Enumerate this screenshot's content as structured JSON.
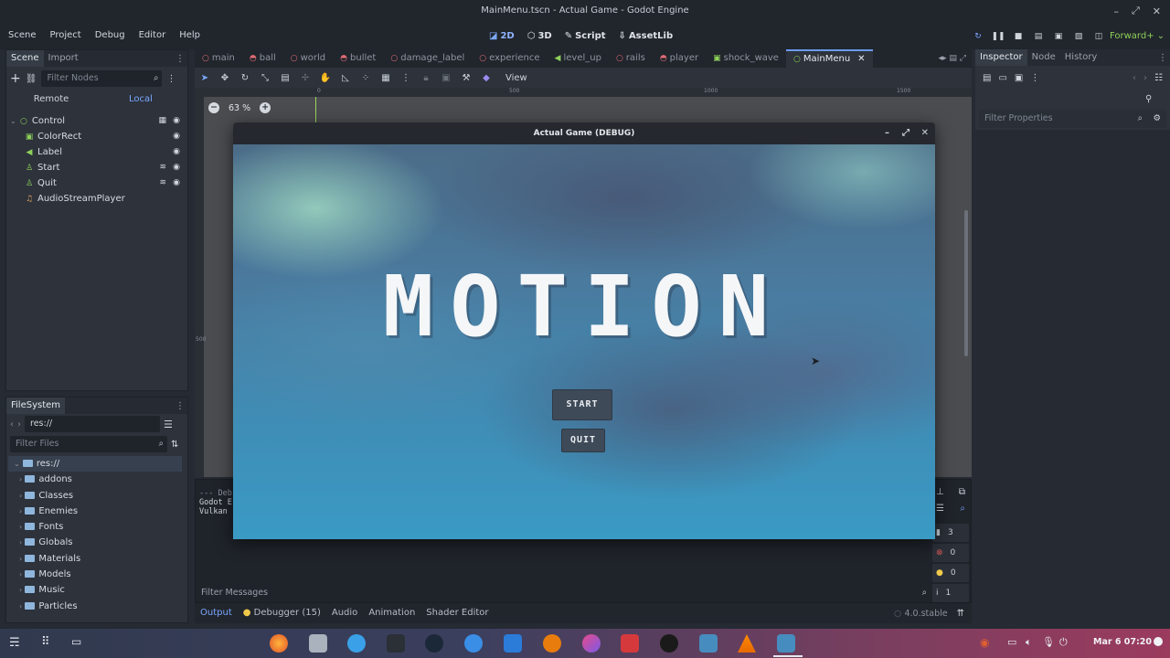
{
  "window_title": "MainMenu.tscn - Actual Game - Godot Engine",
  "menus": [
    "Scene",
    "Project",
    "Debug",
    "Editor",
    "Help"
  ],
  "workspaces": [
    {
      "icon": "2d-icon",
      "label": "2D"
    },
    {
      "icon": "3d-icon",
      "label": "3D"
    },
    {
      "icon": "script-icon",
      "label": "Script"
    },
    {
      "icon": "assetlib-icon",
      "label": "AssetLib"
    }
  ],
  "renderer": "Forward+",
  "scene_dock": {
    "tabs": [
      "Scene",
      "Import"
    ],
    "filter_placeholder": "Filter Nodes",
    "remote": "Remote",
    "local": "Local",
    "nodes": [
      {
        "name": "Control",
        "type": "control",
        "color": "#8ed05a"
      },
      {
        "name": "ColorRect",
        "type": "colorrect",
        "color": "#8ed05a"
      },
      {
        "name": "Label",
        "type": "label",
        "color": "#8ed05a"
      },
      {
        "name": "Start",
        "type": "button",
        "color": "#8ed05a"
      },
      {
        "name": "Quit",
        "type": "button",
        "color": "#8ed05a"
      },
      {
        "name": "AudioStreamPlayer",
        "type": "audio",
        "color": "#e0a060"
      }
    ]
  },
  "filesystem": {
    "tab": "FileSystem",
    "path": "res://",
    "filter_placeholder": "Filter Files",
    "root": "res://",
    "folders": [
      "addons",
      "Classes",
      "Enemies",
      "Fonts",
      "Globals",
      "Materials",
      "Models",
      "Music",
      "Particles"
    ]
  },
  "scene_tabs": [
    {
      "label": "main",
      "color": "#e06c75"
    },
    {
      "label": "ball",
      "color": "#e06c75"
    },
    {
      "label": "world",
      "color": "#e06c75"
    },
    {
      "label": "bullet",
      "color": "#e06c75"
    },
    {
      "label": "damage_label",
      "color": "#e06c75"
    },
    {
      "label": "experience",
      "color": "#e06c75"
    },
    {
      "label": "level_up",
      "color": "#8ed05a"
    },
    {
      "label": "rails",
      "color": "#e06c75"
    },
    {
      "label": "player",
      "color": "#e06c75"
    },
    {
      "label": "shock_wave",
      "color": "#8ed05a"
    },
    {
      "label": "MainMenu",
      "color": "#8ed05a"
    }
  ],
  "toolbar": {
    "view_label": "View"
  },
  "viewport": {
    "zoom": "63 %",
    "ruler_marks": [
      "0",
      "500",
      "1000",
      "1500"
    ],
    "left_ruler_mark": "500"
  },
  "output": {
    "lines": [
      "--- Deb",
      "Godot E",
      "Vulkan "
    ],
    "filter_placeholder": "Filter Messages"
  },
  "counters": {
    "messages": "3",
    "errors": "0",
    "warnings": "0",
    "info": "1"
  },
  "bottom_tabs": {
    "output": "Output",
    "debugger": "Debugger (15)",
    "audio": "Audio",
    "animation": "Animation",
    "shader_editor": "Shader Editor",
    "version": "4.0.stable"
  },
  "inspector": {
    "tabs": [
      "Inspector",
      "Node",
      "History"
    ],
    "filter_placeholder": "Filter Properties"
  },
  "game_window": {
    "title": "Actual Game (DEBUG)",
    "logo": "MOTION",
    "start": "START",
    "quit": "QUIT"
  },
  "taskbar": {
    "date": "Mar 6",
    "time": "07:20"
  }
}
